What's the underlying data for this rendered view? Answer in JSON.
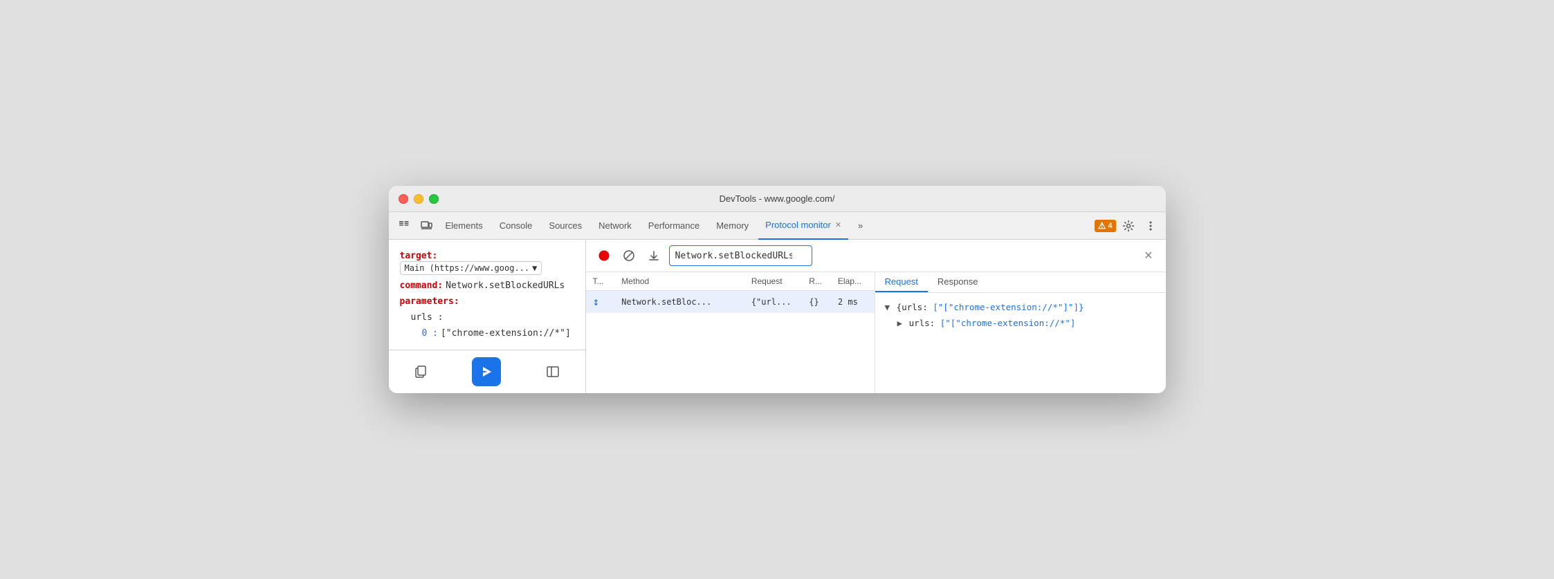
{
  "window": {
    "title": "DevTools - www.google.com/"
  },
  "toolbar": {
    "tabs": [
      {
        "id": "cursor-icon",
        "icon": "⊹",
        "label": null
      },
      {
        "id": "device-icon",
        "icon": "□",
        "label": null
      },
      {
        "label": "Elements",
        "active": false
      },
      {
        "label": "Console",
        "active": false
      },
      {
        "label": "Sources",
        "active": false
      },
      {
        "label": "Network",
        "active": false
      },
      {
        "label": "Performance",
        "active": false
      },
      {
        "label": "Memory",
        "active": false
      },
      {
        "label": "Protocol monitor",
        "active": true,
        "closeable": true
      },
      {
        "label": "»",
        "active": false
      }
    ],
    "notification_count": "4",
    "settings_icon": "⚙",
    "more_icon": "⋮"
  },
  "left_panel": {
    "target_label": "target:",
    "target_value": "Main (https://www.goog...",
    "command_label": "command:",
    "command_value": "Network.setBlockedURLs",
    "parameters_label": "parameters:",
    "urls_label": "urls :",
    "index_label": "0 :",
    "index_value": "[\"chrome-extension://*\"]"
  },
  "right_panel": {
    "record_icon": "⏺",
    "clear_icon": "🚫",
    "download_icon": "⬇",
    "input_value": "Network.setBlockedURLs",
    "input_clear": "✕",
    "table": {
      "headers": [
        "T...",
        "Method",
        "Request",
        "R...",
        "Elap..."
      ],
      "rows": [
        {
          "t": "↕",
          "method": "Network.setBloc...",
          "request": "{\"url...",
          "r": "{}",
          "elapsed": "2 ms",
          "selected": true
        }
      ]
    },
    "tabs": [
      "Request",
      "Response"
    ],
    "active_tab": "Request",
    "response_tree": {
      "root": "▼ {urls: [\"[\"chrome-extension://*\"]\"]}",
      "child": "▶ urls: [\"[\"chrome-extension://*\"]"
    }
  },
  "bottom": {
    "copy_icon": "⧉",
    "send_icon": "▶",
    "sidebar_icon": "⬛"
  },
  "colors": {
    "accent_blue": "#1a73e8",
    "label_red": "#c00000",
    "active_tab_blue": "#1a73e8",
    "selected_row_bg": "#e8f0fe"
  }
}
